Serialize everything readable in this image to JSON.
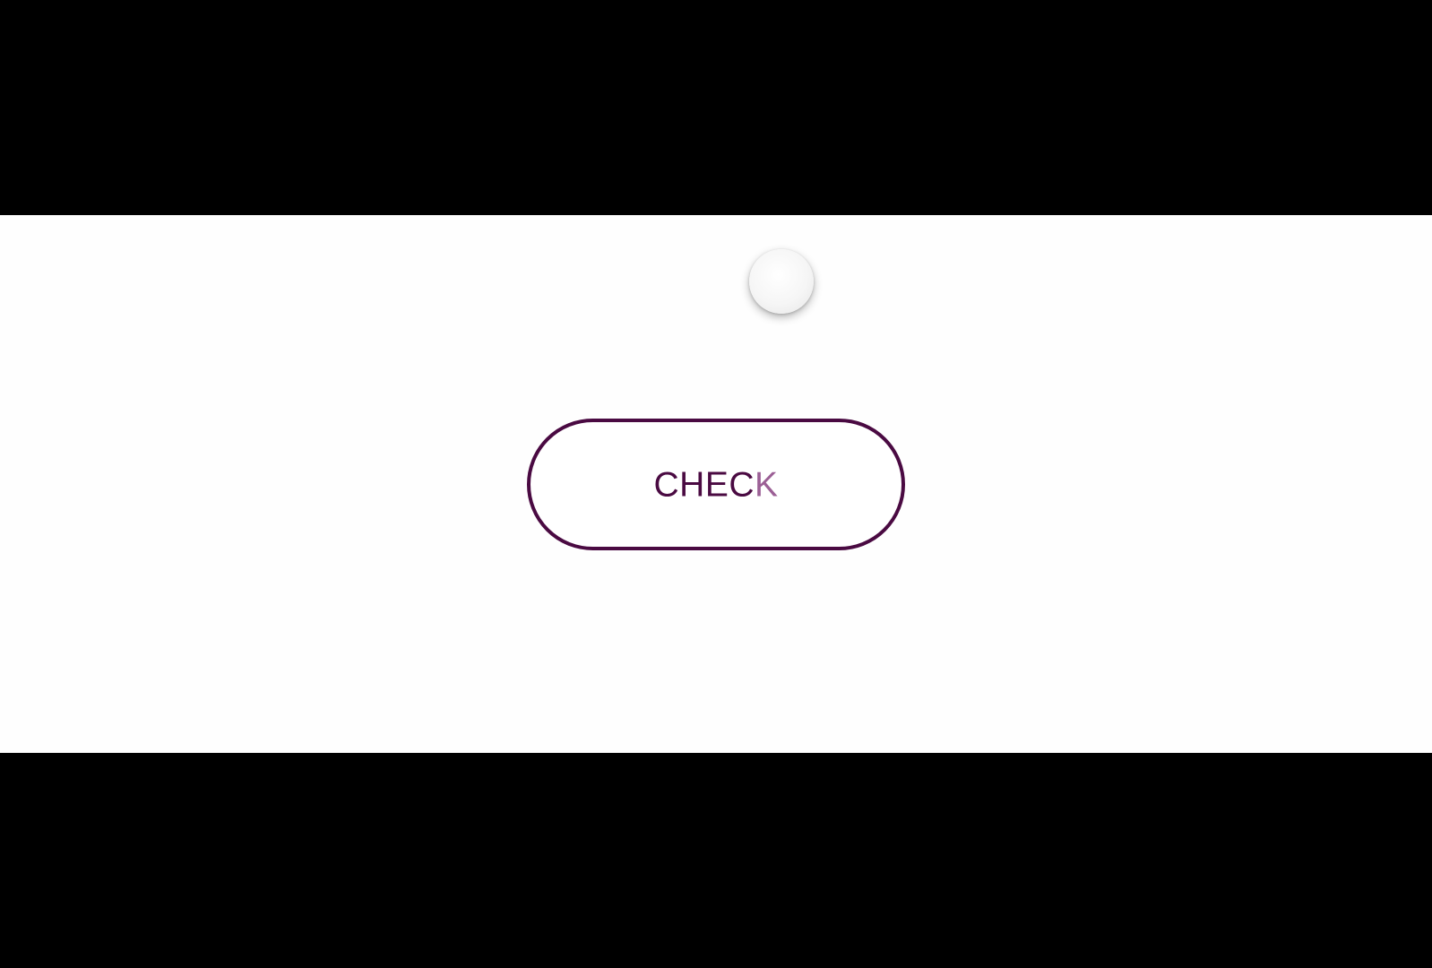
{
  "button": {
    "label_main": "CHEC",
    "label_faded": "K"
  },
  "colors": {
    "accent": "#4a0a42",
    "accent_faded": "#9b5f95",
    "stage_background": "#fefefe",
    "letterbox": "#000000"
  },
  "icons": {
    "cursor": "touch-cursor-icon"
  }
}
